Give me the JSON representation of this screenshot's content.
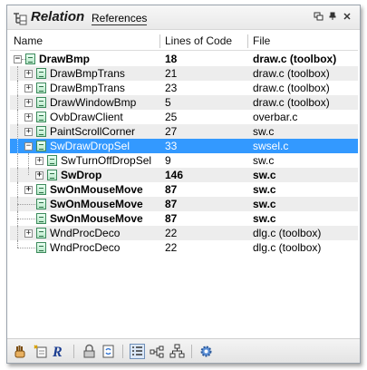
{
  "window": {
    "title": "Relation",
    "references_tab": "References"
  },
  "columns": {
    "name": "Name",
    "lines": "Lines of Code",
    "file": "File"
  },
  "rows": [
    {
      "name": "DrawBmp",
      "lines": "18",
      "file": "draw.c (toolbox)"
    },
    {
      "name": "DrawBmpTrans",
      "lines": "21",
      "file": "draw.c (toolbox)"
    },
    {
      "name": "DrawBmpTrans",
      "lines": "23",
      "file": "draw.c (toolbox)"
    },
    {
      "name": "DrawWindowBmp",
      "lines": "5",
      "file": "draw.c (toolbox)"
    },
    {
      "name": "OvbDrawClient",
      "lines": "25",
      "file": "overbar.c"
    },
    {
      "name": "PaintScrollCorner",
      "lines": "27",
      "file": "sw.c"
    },
    {
      "name": "SwDrawDropSel",
      "lines": "33",
      "file": "swsel.c"
    },
    {
      "name": "SwTurnOffDropSel",
      "lines": "9",
      "file": "sw.c"
    },
    {
      "name": "SwDrop",
      "lines": "146",
      "file": "sw.c"
    },
    {
      "name": "SwOnMouseMove",
      "lines": "87",
      "file": "sw.c"
    },
    {
      "name": "SwOnMouseMove",
      "lines": "87",
      "file": "sw.c"
    },
    {
      "name": "SwOnMouseMove",
      "lines": "87",
      "file": "sw.c"
    },
    {
      "name": "WndProcDeco",
      "lines": "22",
      "file": "dlg.c (toolbox)"
    },
    {
      "name": "WndProcDeco",
      "lines": "22",
      "file": "dlg.c (toolbox)"
    }
  ],
  "icons": {
    "panel": "relation-panel-icon",
    "window_buttons": [
      "float-icon",
      "pin-icon",
      "close-icon"
    ],
    "toolbar": [
      "hand-icon",
      "new-reference-icon",
      "r-logo-icon",
      "lock-icon",
      "sync-icon",
      "outline-view-icon",
      "graph-horizontal-icon",
      "graph-vertical-icon",
      "settings-gear-icon"
    ]
  },
  "colors": {
    "selection": "#3399ff",
    "alt_row": "#ededed",
    "file_icon": "#3c8a5c"
  }
}
